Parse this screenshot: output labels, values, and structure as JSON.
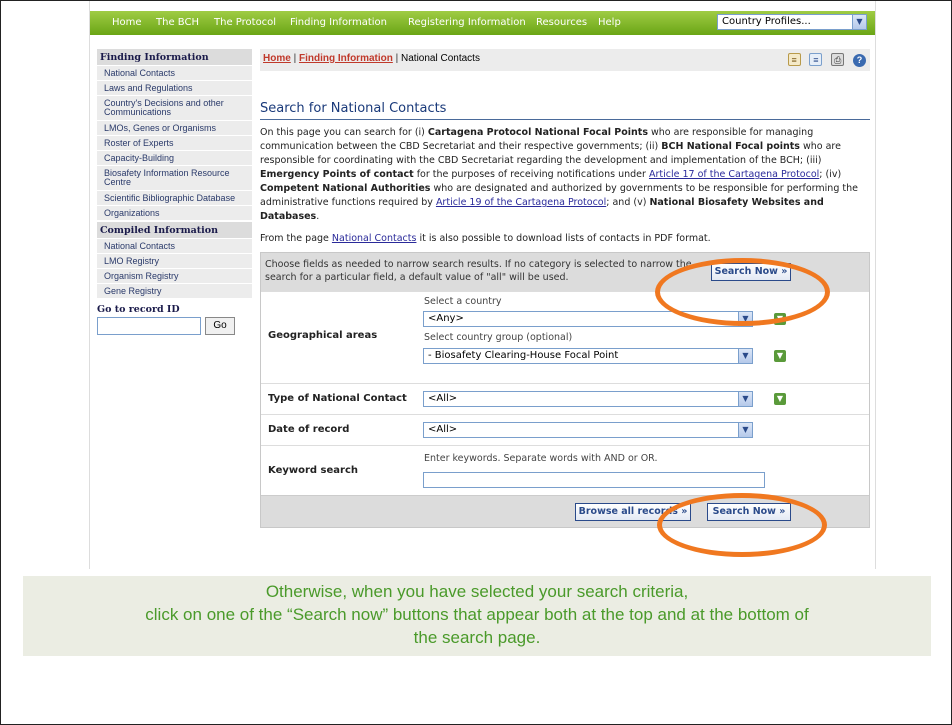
{
  "nav": {
    "items": [
      "Home",
      "The BCH",
      "The Protocol",
      "Finding Information",
      "Registering Information",
      "Resources",
      "Help"
    ],
    "country_profiles": "Country Profiles..."
  },
  "sidebar": {
    "finding_header": "Finding Information",
    "finding_items": [
      "National Contacts",
      "Laws and Regulations",
      "Country's Decisions and other Communications",
      "LMOs, Genes or Organisms",
      "Roster of Experts",
      "Capacity-Building",
      "Biosafety Information Resource Centre",
      "Scientific Bibliographic Database",
      "Organizations"
    ],
    "compiled_header": "Compiled Information",
    "compiled_items": [
      "National Contacts",
      "LMO Registry",
      "Organism Registry",
      "Gene Registry"
    ],
    "goto_label": "Go to record ID",
    "go_button": "Go"
  },
  "breadcrumb": {
    "home": "Home",
    "sep1": "|",
    "finding": "Finding Information",
    "sep2": "|",
    "current": "National Contacts"
  },
  "page_title": "Search for National Contacts",
  "intro": {
    "t1": "On this page you can search for (i) ",
    "b1": "Cartagena Protocol National Focal Points",
    "t2": " who are responsible for managing communication between the CBD Secretariat and their respective governments; (ii) ",
    "b2": "BCH National Focal points",
    "t3": " who are responsible for coordinating with the CBD Secretariat regarding the development and implementation of the BCH; (iii) ",
    "b3": "Emergency Points of contact",
    "t4": " for the purposes of receiving notifications under ",
    "l1": "Article 17 of the Cartagena Protocol",
    "t5": "; (iv) ",
    "b4": "Competent National Authorities",
    "t6": " who are designated and authorized by governments to be responsible for performing the administrative functions required by ",
    "l2": "Article 19 of the Cartagena Protocol",
    "t7": "; and (v) ",
    "b5": "National Biosafety Websites and Databases",
    "t8": "."
  },
  "pdf_note": {
    "t1": "From the page ",
    "link": "National Contacts",
    "t2": " it is also possible to download lists of contacts in PDF format."
  },
  "search": {
    "hint": "Choose fields as needed to narrow search results. If no category is selected to narrow the search for a particular field, a default value of \"all\" will be used.",
    "search_now": "Search Now »",
    "browse_all": "Browse all records »",
    "geo_label": "Geographical areas",
    "select_country_label": "Select a country",
    "country_value": "<Any>",
    "select_group_label": "Select country group (optional)",
    "group_value": "- Biosafety Clearing-House Focal Point",
    "type_label": "Type of National Contact",
    "type_value": "<All>",
    "date_label": "Date of record",
    "date_value": "<All>",
    "keyword_label": "Keyword search",
    "keyword_hint": "Enter keywords. Separate words with AND or OR.",
    "keyword_value": ""
  },
  "caption": {
    "line1": "Otherwise, when you have selected your search criteria,",
    "line2": "click on one of the “Search now” buttons that appear both at the top and at the bottom of",
    "line3": "the search page."
  },
  "colors": {
    "annotation": "#f07820",
    "caption_text": "#4a9a2a",
    "nav_green": "#7ab52a"
  }
}
